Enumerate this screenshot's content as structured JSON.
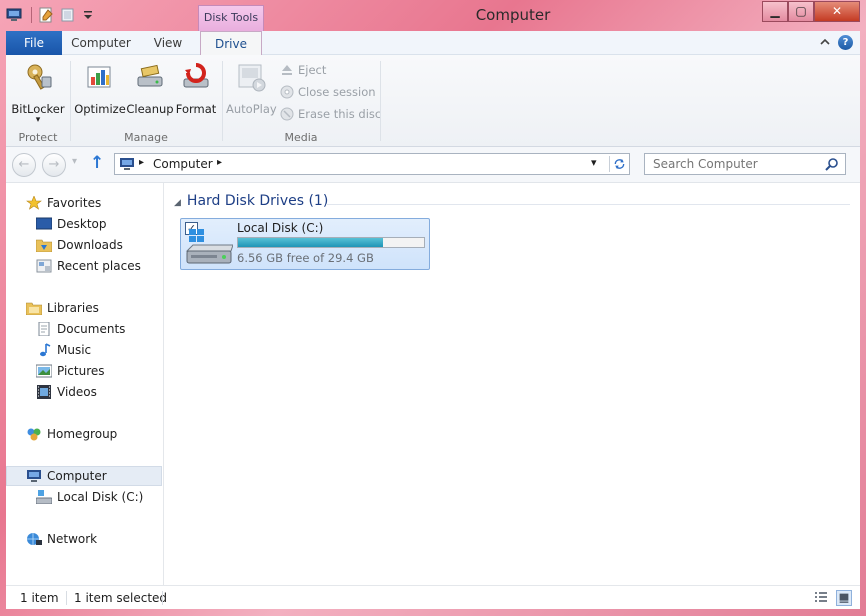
{
  "window": {
    "title": "Computer",
    "contextual_tab": "Disk Tools",
    "controls": {
      "minimize": "▁",
      "maximize": "▢",
      "close": "✕"
    }
  },
  "tabs": [
    {
      "label": "File",
      "active": false
    },
    {
      "label": "Computer",
      "active": false
    },
    {
      "label": "View",
      "active": false
    },
    {
      "label": "Drive",
      "active": true
    }
  ],
  "help_label": "?",
  "ribbon": {
    "protect": {
      "label": "Protect",
      "bitlocker": "BitLocker",
      "dropdown": "▾"
    },
    "manage": {
      "label": "Manage",
      "optimize": "Optimize",
      "cleanup": "Cleanup",
      "format": "Format"
    },
    "media": {
      "label": "Media",
      "autoplay": "AutoPlay",
      "eject": "Eject",
      "close_session": "Close session",
      "erase": "Erase this disc"
    }
  },
  "address": {
    "crumb_sep": "▸",
    "path": "Computer",
    "dropdown": "▾",
    "search_placeholder": "Search Computer",
    "back": "←",
    "forward": "→",
    "recent": "▾",
    "up": "↑"
  },
  "nav": {
    "favorites": {
      "label": "Favorites",
      "items": [
        "Desktop",
        "Downloads",
        "Recent places"
      ]
    },
    "libraries": {
      "label": "Libraries",
      "items": [
        "Documents",
        "Music",
        "Pictures",
        "Videos"
      ]
    },
    "homegroup": "Homegroup",
    "computer": {
      "label": "Computer",
      "items": [
        "Local Disk (C:)"
      ]
    },
    "network": "Network"
  },
  "content": {
    "collapse_glyph": "◢",
    "group_header": "Hard Disk Drives (1)",
    "drive": {
      "name": "Local Disk (C:)",
      "free_text": "6.56 GB free of 29.4 GB",
      "used_fraction": 0.777,
      "checked": "✓"
    }
  },
  "status": {
    "count": "1 item",
    "selection": "1 item selected"
  },
  "colors": {
    "accent": "#1955a9",
    "drive_bar": "#1f95b6",
    "header": "#1e3f86"
  }
}
